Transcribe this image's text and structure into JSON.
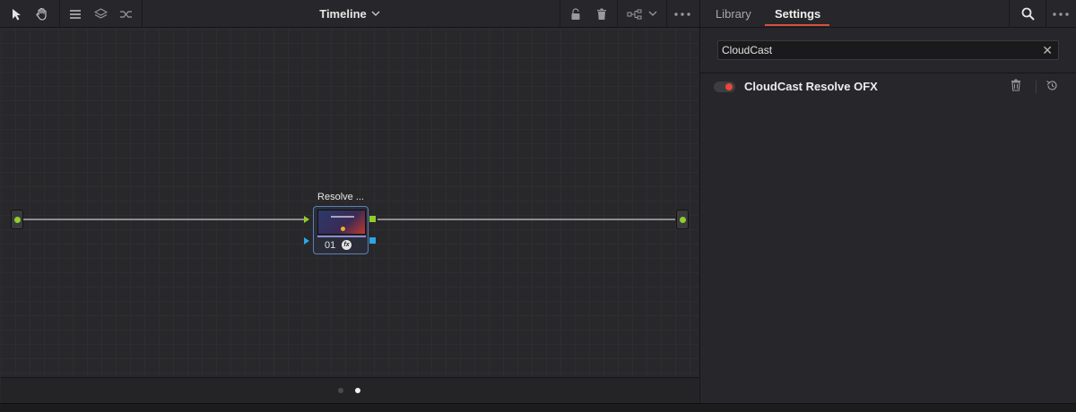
{
  "toolbar": {
    "title": "Timeline",
    "icons": [
      "pointer-icon",
      "hand-icon",
      "align-icon",
      "layers-icon",
      "shuffle-icon",
      "lock-icon",
      "trash-icon",
      "node-graph-icon",
      "chevron-down-icon",
      "more-icon"
    ]
  },
  "node": {
    "label": "Resolve ...",
    "number": "01",
    "badge": "fx"
  },
  "pagination": {
    "pages": 2,
    "active": 2
  },
  "inspector": {
    "tabs": [
      {
        "label": "Library",
        "active": false
      },
      {
        "label": "Settings",
        "active": true
      }
    ],
    "search": {
      "value": "CloudCast",
      "placeholder": ""
    },
    "clear_glyph": "✕",
    "effect": {
      "name": "CloudCast Resolve OFX",
      "enabled": true
    }
  },
  "colors": {
    "accent": "#d9503f",
    "toggle_on": "#e8453b",
    "link_green": "#8fcf2a",
    "link_blue": "#2aa8e8",
    "node_border": "#5d7fb8"
  }
}
